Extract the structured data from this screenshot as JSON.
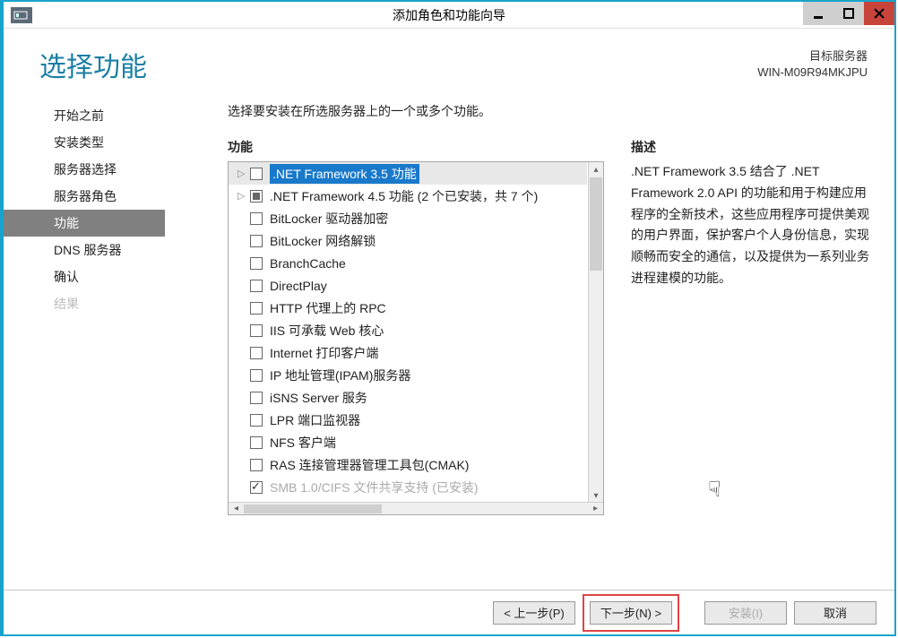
{
  "titlebar": {
    "title": "添加角色和功能向导"
  },
  "header": {
    "page_title": "选择功能",
    "dest_label": "目标服务器",
    "dest_name": "WIN-M09R94MKJPU"
  },
  "sidebar": {
    "items": [
      {
        "label": "开始之前",
        "state": "normal"
      },
      {
        "label": "安装类型",
        "state": "normal"
      },
      {
        "label": "服务器选择",
        "state": "normal"
      },
      {
        "label": "服务器角色",
        "state": "normal"
      },
      {
        "label": "功能",
        "state": "active"
      },
      {
        "label": "DNS 服务器",
        "state": "normal"
      },
      {
        "label": "确认",
        "state": "normal"
      },
      {
        "label": "结果",
        "state": "disabled"
      }
    ]
  },
  "main": {
    "instruction": "选择要安装在所选服务器上的一个或多个功能。",
    "features_label": "功能",
    "description_label": "描述",
    "description_text": ".NET Framework 3.5 结合了 .NET Framework 2.0 API 的功能和用于构建应用程序的全新技术，这些应用程序可提供美观的用户界面，保护客户个人身份信息，实现顺畅而安全的通信，以及提供为一系列业务进程建模的功能。",
    "features": [
      {
        "label": ".NET Framework 3.5 功能",
        "expander": "▷",
        "check": "unchecked",
        "selected": true,
        "highlight": true
      },
      {
        "label": ".NET Framework 4.5 功能 (2 个已安装，共 7 个)",
        "expander": "▷",
        "check": "partial",
        "selected": false
      },
      {
        "label": "BitLocker 驱动器加密",
        "expander": "",
        "check": "unchecked"
      },
      {
        "label": "BitLocker 网络解锁",
        "expander": "",
        "check": "unchecked"
      },
      {
        "label": "BranchCache",
        "expander": "",
        "check": "unchecked"
      },
      {
        "label": "DirectPlay",
        "expander": "",
        "check": "unchecked"
      },
      {
        "label": "HTTP 代理上的 RPC",
        "expander": "",
        "check": "unchecked"
      },
      {
        "label": "IIS 可承载 Web 核心",
        "expander": "",
        "check": "unchecked"
      },
      {
        "label": "Internet 打印客户端",
        "expander": "",
        "check": "unchecked"
      },
      {
        "label": "IP 地址管理(IPAM)服务器",
        "expander": "",
        "check": "unchecked"
      },
      {
        "label": "iSNS Server 服务",
        "expander": "",
        "check": "unchecked"
      },
      {
        "label": "LPR 端口监视器",
        "expander": "",
        "check": "unchecked"
      },
      {
        "label": "NFS 客户端",
        "expander": "",
        "check": "unchecked"
      },
      {
        "label": "RAS 连接管理器管理工具包(CMAK)",
        "expander": "",
        "check": "unchecked"
      },
      {
        "label": "SMB 1.0/CIFS 文件共享支持 (已安装)",
        "expander": "",
        "check": "checked",
        "cutoff": true
      }
    ]
  },
  "footer": {
    "prev": "< 上一步(P)",
    "next": "下一步(N) >",
    "install": "安装(I)",
    "cancel": "取消"
  },
  "watermark": ""
}
